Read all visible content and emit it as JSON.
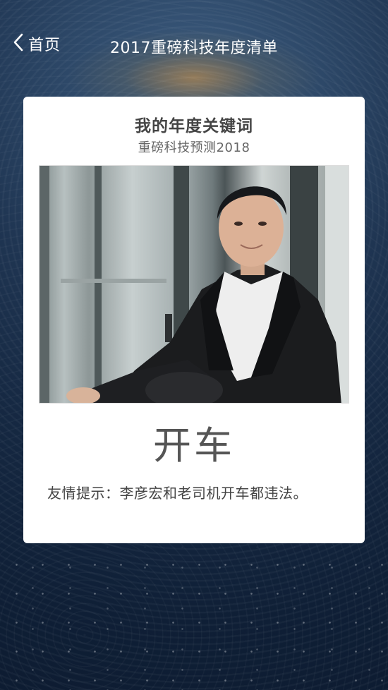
{
  "header": {
    "back_label": "首页",
    "title": "2017重磅科技年度清单"
  },
  "card": {
    "title": "我的年度关键词",
    "subtitle": "重磅科技预测2018",
    "keyword": "开车",
    "tip": "友情提示：李彦宏和老司机开车都违法。"
  },
  "icons": {
    "back": "chevron-left-icon"
  },
  "colors": {
    "background": "#1f3552",
    "card": "#ffffff",
    "text_light": "#ffffff",
    "text_dark": "#444444"
  }
}
